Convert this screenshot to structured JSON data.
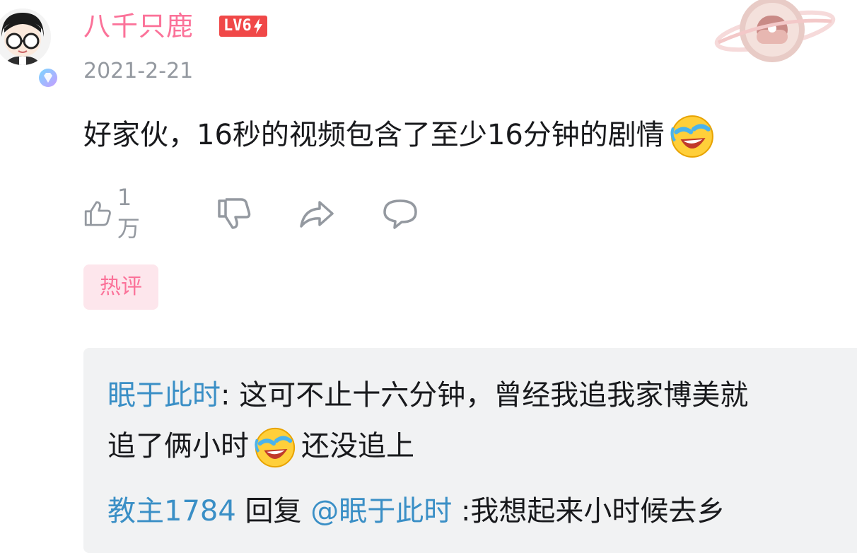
{
  "comment": {
    "username": "八千只鹿",
    "level": "LV6",
    "date": "2021-2-21",
    "text": "好家伙，16秒的视频包含了至少16分钟的剧情",
    "like_count": "1万",
    "hot_tag": "热评"
  },
  "replies": [
    {
      "name": "眠于此时",
      "text_line1": ": 这可不止十六分钟，曾经我追我家博美就",
      "text_line2_a": "追了俩小时",
      "text_line2_b": "还没追上"
    },
    {
      "name": "教主1784",
      "reply_word": " 回复 ",
      "mention": "@眠于此时",
      "text": " :我想起来小时候去乡"
    }
  ],
  "colors": {
    "username": "#fb7299",
    "level_badge": "#f04848",
    "reply_name": "#3a8fc6",
    "meta_text": "#9499a0",
    "hot_tag_bg": "#fde6ec"
  },
  "icons": [
    "avatar",
    "verified-badge-icon",
    "level-bolt-icon",
    "pendant-planet-icon",
    "laughing-cry-emoji",
    "thumb-up-icon",
    "thumb-down-icon",
    "share-icon",
    "reply-comment-icon"
  ]
}
